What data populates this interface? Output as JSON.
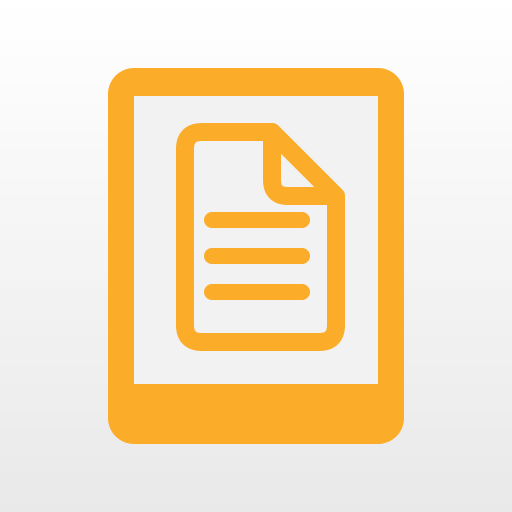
{
  "app_icon": {
    "name": "document-reader-icon",
    "colors": {
      "accent": "#FBAC29",
      "background_top": "#FFFFFF",
      "background_bottom": "#E9E9E9",
      "screen": "#F2F2F2"
    }
  }
}
